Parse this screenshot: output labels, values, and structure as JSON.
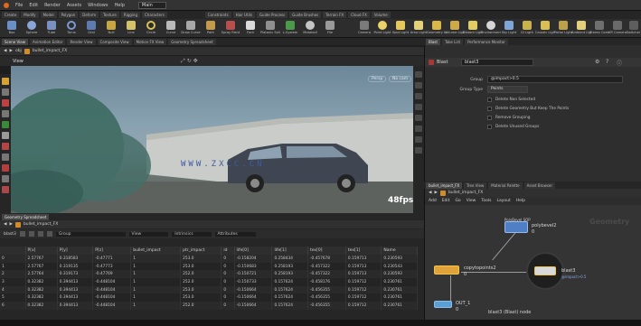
{
  "menubar": {
    "items": [
      "File",
      "Edit",
      "Render",
      "Assets",
      "Windows",
      "Help"
    ],
    "desktop": "Main"
  },
  "shelf_tabs": [
    "Create",
    "Modify",
    "Model",
    "Polygon",
    "Deform",
    "Texture",
    "Rigging",
    "Characters",
    "Constraints",
    "Hair Utils",
    "Guide Process",
    "Guide Brushes",
    "Terrain FX",
    "Cloud FX",
    "Volume"
  ],
  "shelf_tools": [
    "Box",
    "Sphere",
    "Tube",
    "Torus",
    "Grid",
    "Null",
    "Line",
    "Circle",
    "Curve",
    "Draw Curve",
    "Path",
    "Spray Paint",
    "Font",
    "Platonic Solids",
    "L-System",
    "Metaball",
    "File"
  ],
  "light_tools": [
    "Camera",
    "Point Light",
    "Spot Light",
    "Area Light",
    "Geometry Light",
    "Volume Light",
    "Distant Light",
    "Environment Light",
    "Sky Light",
    "GI Light",
    "Caustic Light",
    "Portal Light",
    "Ambient Light",
    "Stereo Camera",
    "VR Camera",
    "Switcher"
  ],
  "scene_tabs": [
    "Scene View",
    "Animation Editor",
    "Render View",
    "Composite View",
    "Motion FX View",
    "Geometry Spreadsheet"
  ],
  "scene_path": {
    "obj": "obj",
    "node": "bullet_impact_FX"
  },
  "viewport": {
    "label": "View",
    "persp": "Persp",
    "camera": "No cam",
    "fps": "48fps",
    "watermark": "WWW.ZXCC.CN"
  },
  "spreadsheet": {
    "tab": "Geometry Spreadsheet",
    "path_node": "bullet_impact_FX",
    "node": "blast3",
    "group_label": "Group",
    "view_label": "View",
    "intrinsics_label": "Intrinsics",
    "attributes_label": "Attributes",
    "columns": [
      "",
      "P[x]",
      "P[y]",
      "P[z]",
      "bullet_impact",
      "ptr_impact",
      "id",
      "life[0]",
      "life[1]",
      "tex[0]",
      "tex[1]",
      "Name"
    ],
    "rows": [
      [
        "0",
        "2.57767",
        "0.318583",
        "-0.47771",
        "1",
        "253.0",
        "0",
        "-0.158204",
        "0.258434",
        "-0.457678",
        "0.159713",
        "0.230593"
      ],
      [
        "1",
        "2.57767",
        "0.319135",
        "-0.47773",
        "1",
        "253.0",
        "0",
        "-0.150683",
        "0.258193",
        "-0.457322",
        "0.159713",
        "0.230543"
      ],
      [
        "2",
        "2.57764",
        "0.319173",
        "-0.47769",
        "1",
        "252.0",
        "0",
        "-0.150721",
        "0.258193",
        "-0.457322",
        "0.159713",
        "0.230593"
      ],
      [
        "3",
        "0.32382",
        "0.394413",
        "-0.448104",
        "1",
        "252.0",
        "0",
        "-0.150733",
        "0.157624",
        "-0.458176",
        "0.159712",
        "0.230761"
      ],
      [
        "4",
        "0.32382",
        "0.394413",
        "-0.448104",
        "1",
        "253.0",
        "0",
        "-0.150664",
        "0.157624",
        "-0.456355",
        "0.159712",
        "0.230761"
      ],
      [
        "5",
        "0.32382",
        "0.394413",
        "-0.448104",
        "1",
        "253.0",
        "0",
        "-0.150664",
        "0.157624",
        "-0.456355",
        "0.159712",
        "0.230761"
      ],
      [
        "6",
        "0.32382",
        "0.394413",
        "-0.448104",
        "1",
        "252.0",
        "0",
        "-0.150664",
        "0.157624",
        "-0.456355",
        "0.159712",
        "0.230761"
      ]
    ]
  },
  "params": {
    "tabs": [
      "Blast",
      "Take List",
      "Performance Monitor"
    ],
    "node_type": "Blast",
    "node_name": "blast3",
    "group_label": "Group",
    "group_value": "@impact>0.5",
    "group_type_label": "Group Type",
    "group_type_value": "Points",
    "options": [
      "Delete Non Selected",
      "Delete Geometry But Keep The Points",
      "Remove Grouping",
      "Delete Unused Groups"
    ]
  },
  "network": {
    "tabs": [
      "bullet_impact_FX",
      "Tree View",
      "Material Palette",
      "Asset Browser"
    ],
    "path_node": "bullet_impact_FX",
    "menu": [
      "Add",
      "Edit",
      "Go",
      "View",
      "Tools",
      "Layout",
      "Help"
    ],
    "context_label": "Geometry",
    "nodes": {
      "polybevel": {
        "name": "polybevel2",
        "flag": "0",
        "type": "PolyBevel SOP"
      },
      "copytopoints": {
        "name": "copytopoints2",
        "flag": "0"
      },
      "blast": {
        "name": "blast3",
        "group": "@impact>0.5"
      },
      "null": {
        "name": "OUT_1",
        "flag": "0"
      }
    },
    "caption": "blast3 (Blast) node"
  },
  "colors": {
    "accent": "#e0a23a",
    "selection": "#f4c542",
    "node_blue": "#4f7fc4"
  }
}
